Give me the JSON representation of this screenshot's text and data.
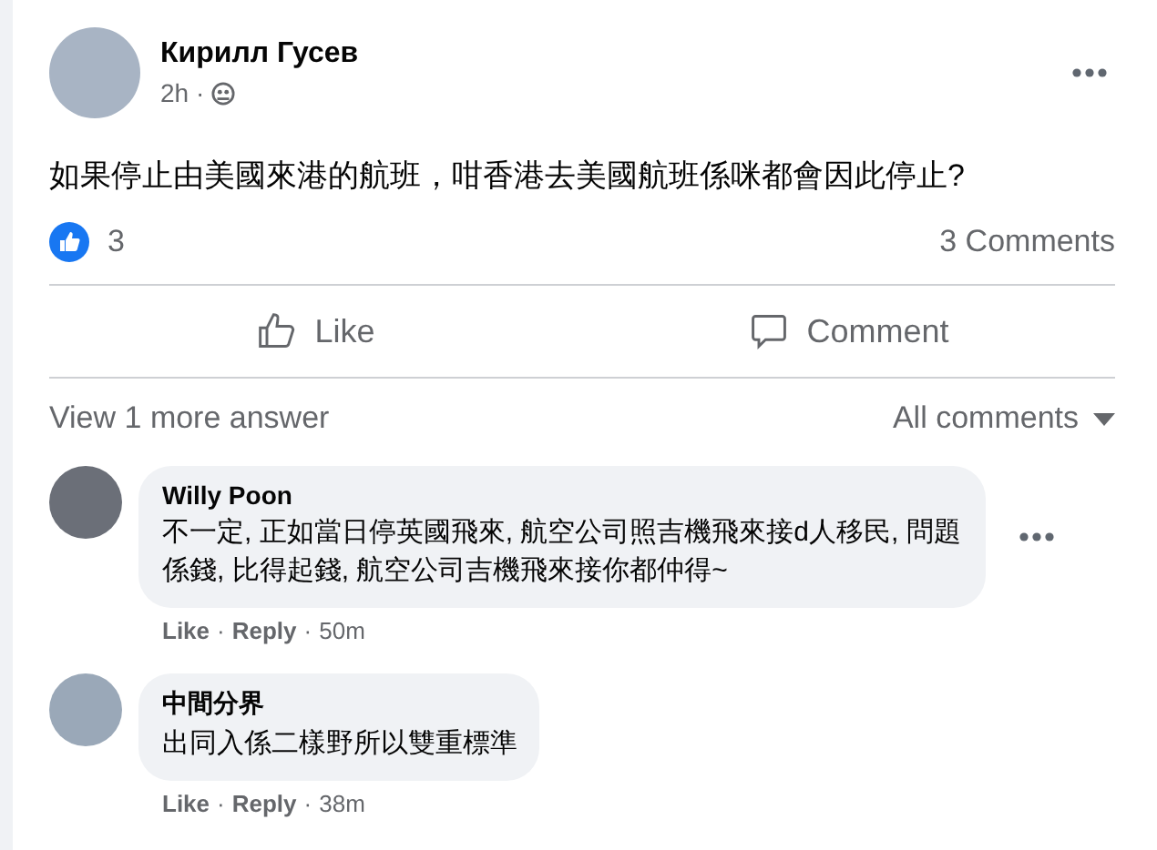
{
  "post": {
    "author": "Кирилл Гусев",
    "time": "2h ·",
    "text": "如果停止由美國來港的航班，咁香港去美國航班係咪都會因此停止?",
    "reaction_count": "3",
    "comment_count": "3 Comments"
  },
  "actions": [
    {
      "kind": "like",
      "label": "Like"
    },
    {
      "kind": "comment",
      "label": "Comment"
    }
  ],
  "comments_bar": {
    "view_more": "View 1 more answer",
    "sort": "All comments"
  },
  "separator": "·",
  "comments": [
    {
      "author": "Willy Poon",
      "text": "不一定, 正如當日停英國飛來, 航空公司照吉機飛來接d人移民, 問題係錢, 比得起錢, 航空公司吉機飛來接你都仲得~",
      "like": "Like",
      "reply": "Reply",
      "time": "50m",
      "menu": true
    },
    {
      "author": "中間分界",
      "text": "出同入係二樣野所以雙重標準",
      "like": "Like",
      "reply": "Reply",
      "time": "38m",
      "menu": false
    }
  ]
}
